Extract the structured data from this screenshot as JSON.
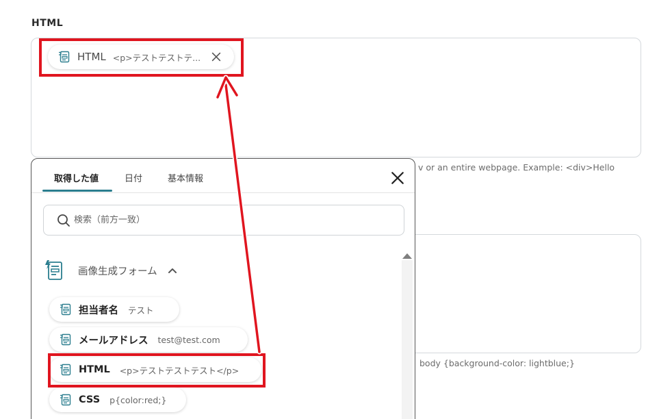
{
  "html_field": {
    "label": "HTML",
    "chip": {
      "title": "HTML",
      "value": "<p>テストテストテ..."
    },
    "helper_text": "v or an entire webpage. Example: <div>Hello"
  },
  "css_field": {
    "helper_text": "body {background-color: lightblue;}"
  },
  "popup": {
    "tabs": [
      {
        "label": "取得した値",
        "active": true
      },
      {
        "label": "日付",
        "active": false
      },
      {
        "label": "基本情報",
        "active": false
      }
    ],
    "search": {
      "placeholder": "検索（前方一致）",
      "value": ""
    },
    "group": {
      "title": "画像生成フォーム",
      "expanded": true
    },
    "items": [
      {
        "title": "担当者名",
        "value": "テスト"
      },
      {
        "title": "メールアドレス",
        "value": "test@test.com"
      },
      {
        "title": "HTML",
        "value": "<p>テストテストテスト</p>"
      },
      {
        "title": "CSS",
        "value": "p{color:red;}"
      }
    ]
  },
  "colors": {
    "accent": "#2a7d8e",
    "highlight": "#e0151f",
    "icon": "#2a7d8e"
  },
  "icons": {
    "chip_icon": "form-field-icon",
    "group_icon": "form-lightning-icon",
    "search_icon": "search-icon",
    "close_icon": "close-icon",
    "chevron_icon": "chevron-up-icon"
  }
}
